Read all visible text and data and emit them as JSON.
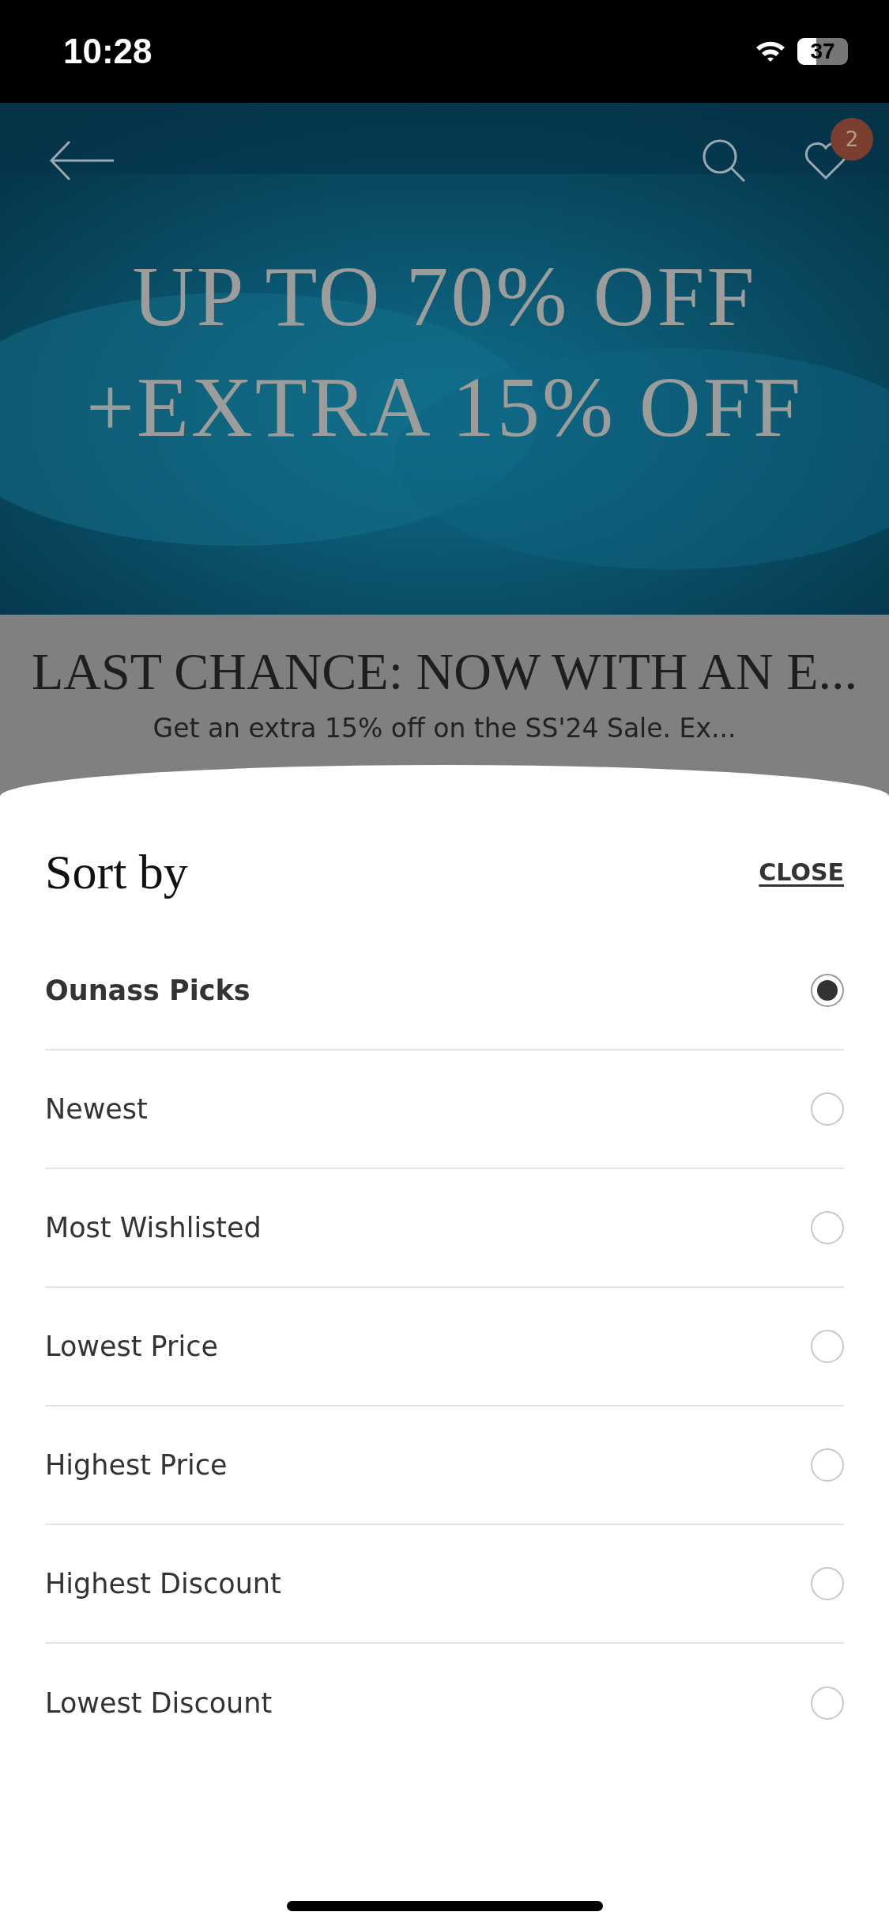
{
  "status_bar": {
    "time": "10:28",
    "battery": "37"
  },
  "header": {
    "wishlist_count": "2"
  },
  "hero": {
    "lines": [
      "UP TO 70% OFF",
      "+EXTRA 15% OFF"
    ]
  },
  "promo": {
    "title": "LAST CHANCE: NOW WITH AN E...",
    "subtitle": "Get an extra 15% off on the SS'24 Sale. Ex..."
  },
  "sheet": {
    "title": "Sort by",
    "close": "CLOSE",
    "options": [
      {
        "label": "Ounass Picks",
        "selected": true
      },
      {
        "label": "Newest",
        "selected": false
      },
      {
        "label": "Most Wishlisted",
        "selected": false
      },
      {
        "label": "Lowest Price",
        "selected": false
      },
      {
        "label": "Highest Price",
        "selected": false
      },
      {
        "label": "Highest Discount",
        "selected": false
      },
      {
        "label": "Lowest Discount",
        "selected": false
      }
    ]
  }
}
